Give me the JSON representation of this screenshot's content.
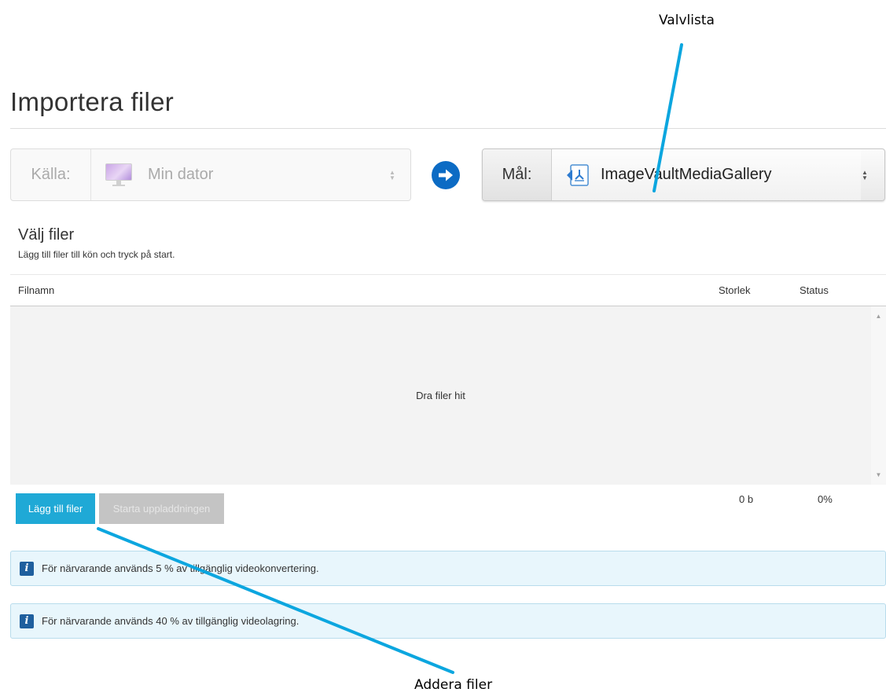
{
  "annotations": {
    "top": "Valvlista",
    "bottom": "Addera filer"
  },
  "page": {
    "title": "Importera filer"
  },
  "source": {
    "label": "Källa:",
    "value": "Min dator",
    "icon": "computer-icon"
  },
  "target": {
    "label": "Mål:",
    "value": "ImageVaultMediaGallery",
    "icon": "imagevault-icon"
  },
  "files": {
    "heading": "Välj filer",
    "subheading": "Lägg till filer till kön och tryck på start.",
    "columns": {
      "filename": "Filnamn",
      "size": "Storlek",
      "status": "Status"
    },
    "dropzone_text": "Dra filer hit",
    "add_button": "Lägg till filer",
    "start_button": "Starta uppladdningen",
    "total_size": "0 b",
    "total_status": "0%"
  },
  "info": [
    {
      "text": "För närvarande används 5 % av tillgänglig videokonvertering."
    },
    {
      "text": "För närvarande används 40 % av tillgänglig videolagring."
    }
  ],
  "colors": {
    "accent": "#1fa9d6",
    "arrow_circle": "#0c6bc4",
    "annotation_line": "#0ca6df",
    "info_bg": "#e8f6fc"
  }
}
